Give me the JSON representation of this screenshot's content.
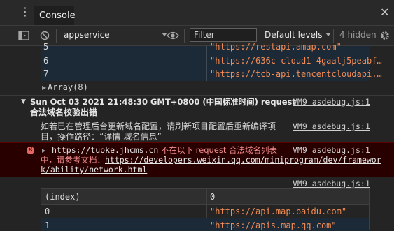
{
  "tabbar": {
    "console_tab": "Console"
  },
  "toolbar": {
    "context": "appservice",
    "filter_placeholder": "Filter",
    "levels": "Default levels",
    "hidden": "4 hidden"
  },
  "top_table": {
    "rows": [
      {
        "index": "5",
        "value": "\"https://restapi.amap.com\""
      },
      {
        "index": "6",
        "value": "\"https://636c-cloud1-4gaalj5peabf…"
      },
      {
        "index": "7",
        "value": "\"https://tcb-api.tencentcloudapi.…"
      }
    ],
    "array_label": "Array(8)"
  },
  "group": {
    "title_line1": "Sun Oct 03 2021 21:48:30 GMT+0800 (中国标准时间) request",
    "title_line2": "合法域名校验出错",
    "source": "VM9 asdebug.js:1"
  },
  "info": {
    "line1": "如若已在管理后台更新域名配置，请刷新项目配置后重新编译项",
    "line2": "目，操作路径：“详情-域名信息”",
    "source": "VM9 asdebug.js:1"
  },
  "error": {
    "link": "https://tuoke.jhcms.cn",
    "msg1": " 不在以下 request 合法域名列表",
    "msg2": "中，请参考文档：",
    "doc_link1": "https://developers.weixin.qq.com/miniprogram/dev/framewor",
    "doc_link2": "k/ability/network.html",
    "source": "VM9 asdebug.js:1"
  },
  "bottom": {
    "source": "VM9 asdebug.js:1",
    "table_header_index": "(index)",
    "table_header_value": "0",
    "rows": [
      {
        "index": "0",
        "value": "\"https://api.map.baidu.com\""
      },
      {
        "index": "1",
        "value": "\"https://apis.map.qq.com\""
      }
    ]
  }
}
